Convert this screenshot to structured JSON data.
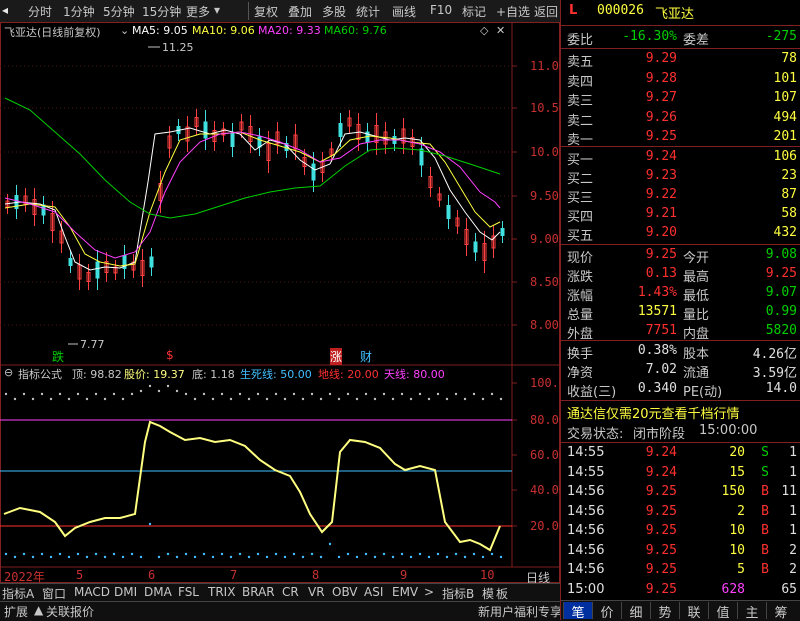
{
  "toolbar": {
    "items": [
      "分时",
      "1分钟",
      "5分钟",
      "15分钟",
      "更多",
      "复权",
      "叠加",
      "多股",
      "统计",
      "画线",
      "F10",
      "+自选",
      "返回"
    ]
  },
  "chart_header": {
    "name": "飞亚达(日线前复权)",
    "ma5": "MA5: 9.05",
    "ma10": "MA10: 9.06",
    "ma20": "MA20: 9.33",
    "ma60": "MA60: 9.76"
  },
  "price_axis": [
    "11.00",
    "10.50",
    "10.00",
    "9.50",
    "9.00",
    "8.50",
    "8.00"
  ],
  "annotations": {
    "high": "11.25",
    "low": "7.77",
    "marker_die": "跌",
    "marker_s": "$",
    "marker_zhang": "涨",
    "marker_cai": "财"
  },
  "indicator": {
    "title": "指标公式",
    "top_label": "顶: 98.82",
    "price_label": "股价: 19.37",
    "bottom_label": "底: 1.18",
    "lifeline_label": "生死线: 50.00",
    "groundline_label": "地线: 20.00",
    "skyline_label": "天线: 80.00",
    "axis": [
      "100.0",
      "80.00",
      "60.00",
      "40.00",
      "20.00"
    ]
  },
  "date_axis": [
    "2022年",
    "5",
    "6",
    "7",
    "8",
    "9",
    "10",
    "日线"
  ],
  "tabs": [
    "指标A",
    "窗口",
    "MACD",
    "DMI",
    "DMA",
    "FSL",
    "TRIX",
    "BRAR",
    "CR",
    "VR",
    "OBV",
    "ASI",
    "EMV",
    ">",
    "指标B",
    "模",
    "板"
  ],
  "status": {
    "left1": "扩展",
    "left2": "关联报价",
    "promo": "新用户福利专享",
    "bottom_tabs": [
      "笔",
      "价",
      "细",
      "势",
      "联",
      "值",
      "主",
      "筹"
    ]
  },
  "panel": {
    "flag": "L",
    "code": "000026",
    "name": "飞亚达",
    "weibi_label": "委比",
    "weibi_value": "-16.30%",
    "weicha_label": "委差",
    "weicha_value": "-275",
    "asks": [
      {
        "label": "卖五",
        "price": "9.29",
        "vol": "78"
      },
      {
        "label": "卖四",
        "price": "9.28",
        "vol": "101"
      },
      {
        "label": "卖三",
        "price": "9.27",
        "vol": "107"
      },
      {
        "label": "卖二",
        "price": "9.26",
        "vol": "494"
      },
      {
        "label": "卖一",
        "price": "9.25",
        "vol": "201"
      }
    ],
    "bids": [
      {
        "label": "买一",
        "price": "9.24",
        "vol": "106"
      },
      {
        "label": "买二",
        "price": "9.23",
        "vol": "23"
      },
      {
        "label": "买三",
        "price": "9.22",
        "vol": "87"
      },
      {
        "label": "买四",
        "price": "9.21",
        "vol": "58"
      },
      {
        "label": "买五",
        "price": "9.20",
        "vol": "432"
      }
    ],
    "quote": [
      {
        "l1": "现价",
        "v1": "9.25",
        "l2": "今开",
        "v2": "9.08"
      },
      {
        "l1": "涨跌",
        "v1": "0.13",
        "l2": "最高",
        "v2": "9.25"
      },
      {
        "l1": "涨幅",
        "v1": "1.43%",
        "l2": "最低",
        "v2": "9.07"
      },
      {
        "l1": "总量",
        "v1": "13571",
        "l2": "量比",
        "v2": "0.99"
      },
      {
        "l1": "外盘",
        "v1": "7751",
        "l2": "内盘",
        "v2": "5820"
      }
    ],
    "fund": [
      {
        "l1": "换手",
        "v1": "0.38%",
        "l2": "股本",
        "v2": "4.26亿"
      },
      {
        "l1": "净资",
        "v1": "7.02",
        "l2": "流通",
        "v2": "3.59亿"
      },
      {
        "l1": "收益(三)",
        "v1": "0.340",
        "l2": "PE(动)",
        "v2": "14.0"
      }
    ],
    "promo": "通达信仅需20元查看千档行情",
    "trade_state_label": "交易状态:",
    "trade_state_value": "闭市阶段",
    "trade_state_time": "15:00:00",
    "ticks": [
      {
        "time": "14:55",
        "price": "9.24",
        "vol": "20",
        "dir": "S",
        "n": "1"
      },
      {
        "time": "14:55",
        "price": "9.24",
        "vol": "15",
        "dir": "S",
        "n": "1"
      },
      {
        "time": "14:56",
        "price": "9.25",
        "vol": "150",
        "dir": "B",
        "n": "11"
      },
      {
        "time": "14:56",
        "price": "9.25",
        "vol": "2",
        "dir": "B",
        "n": "1"
      },
      {
        "time": "14:56",
        "price": "9.25",
        "vol": "10",
        "dir": "B",
        "n": "1"
      },
      {
        "time": "14:56",
        "price": "9.25",
        "vol": "10",
        "dir": "B",
        "n": "2"
      },
      {
        "time": "14:56",
        "price": "9.25",
        "vol": "5",
        "dir": "B",
        "n": "2"
      },
      {
        "time": "15:00",
        "price": "9.25",
        "vol": "628",
        "dir": "",
        "n": "65"
      }
    ]
  }
}
